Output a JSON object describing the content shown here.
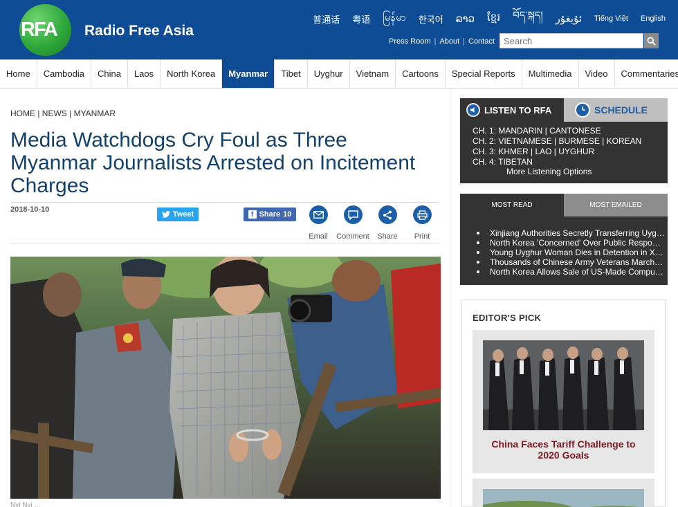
{
  "header": {
    "logo_text": "RFA",
    "site_name": "Radio Free Asia",
    "languages": [
      "普通话",
      "粤语",
      "မြန်မာ",
      "한국어",
      "ລາວ",
      "ខ្មែរ",
      "བོད་སྐད།",
      "ئۇيغۇر",
      "Tiếng Việt",
      "English"
    ],
    "top_links": [
      "Press Room",
      "About",
      "Contact"
    ],
    "search_placeholder": "Search"
  },
  "nav": {
    "items": [
      "Home",
      "Cambodia",
      "China",
      "Laos",
      "North Korea",
      "Myanmar",
      "Tibet",
      "Uyghur",
      "Vietnam",
      "Cartoons",
      "Special Reports",
      "Multimedia",
      "Video",
      "Commentaries"
    ],
    "active": "Myanmar"
  },
  "article": {
    "breadcrumb": "HOME | NEWS | MYANMAR",
    "headline": "Media Watchdogs Cry Foul as Three Myanmar Journalists Arrested on Incitement Charges",
    "date": "2018-10-10",
    "tweet_label": "Tweet",
    "share_label": "Share",
    "share_count": "10",
    "tools": [
      "Email",
      "Comment",
      "Share",
      "Print"
    ],
    "caption": "Nyi Nyi ..."
  },
  "listen": {
    "tab_listen": "LISTEN TO RFA",
    "tab_schedule": "SCHEDULE",
    "channels": [
      "CH. 1: MANDARIN | CANTONESE",
      "CH. 2: VIETNAMESE | BURMESE | KOREAN",
      "CH. 3: KHMER | LAO | UYGHUR",
      "CH. 4: TIBETAN"
    ],
    "more": "More Listening Options"
  },
  "most": {
    "tab_read": "MOST READ",
    "tab_emailed": "MOST EMAILED",
    "items": [
      "Xinjiang Authorities Secretly Transferring Uyghur Detainees",
      "North Korea 'Concerned' Over Public Response",
      "Young Uyghur Woman Dies in Detention in Xinjiang",
      "Thousands of Chinese Army Veterans March on Beijing",
      "North Korea Allows Sale of US-Made Computers"
    ]
  },
  "editors_pick": {
    "title": "EDITOR'S PICK",
    "story": "China Faces Tariff Challenge to 2020 Goals"
  },
  "colors": {
    "brand_blue": "#0e4c96",
    "logo_green": "#2ea83a",
    "headline_blue": "#13416e",
    "pick_red": "#7a1a22"
  }
}
